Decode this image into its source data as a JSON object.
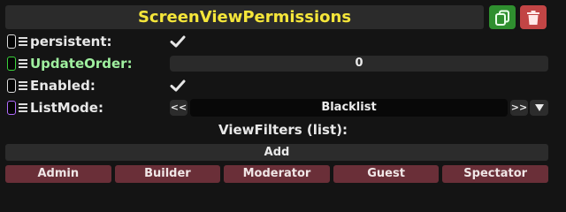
{
  "component": {
    "title": "ScreenViewPermissions",
    "duplicate_icon": "duplicate-icon",
    "delete_icon": "trash-icon",
    "title_color": "#f5e63a",
    "duplicate_color": "#2f8f2f",
    "delete_color": "#c24545"
  },
  "fields": [
    {
      "label": "persistent:",
      "type": "checkbox",
      "checked": true,
      "handle_color": "#dcdcdc"
    },
    {
      "label": "UpdateOrder:",
      "type": "number",
      "value": "0",
      "handle_color": "#3ad13a",
      "label_color": "#9ff09f"
    },
    {
      "label": "Enabled:",
      "type": "checkbox",
      "checked": true,
      "handle_color": "#dcdcdc"
    },
    {
      "label": "ListMode:",
      "type": "enum",
      "value": "Blacklist",
      "prev": "<<",
      "next": ">>",
      "handle_color": "#b06cff"
    }
  ],
  "view_filters": {
    "title": "ViewFilters (list):",
    "add_label": "Add",
    "items": [
      "Admin",
      "Builder",
      "Moderator",
      "Guest",
      "Spectator"
    ]
  }
}
